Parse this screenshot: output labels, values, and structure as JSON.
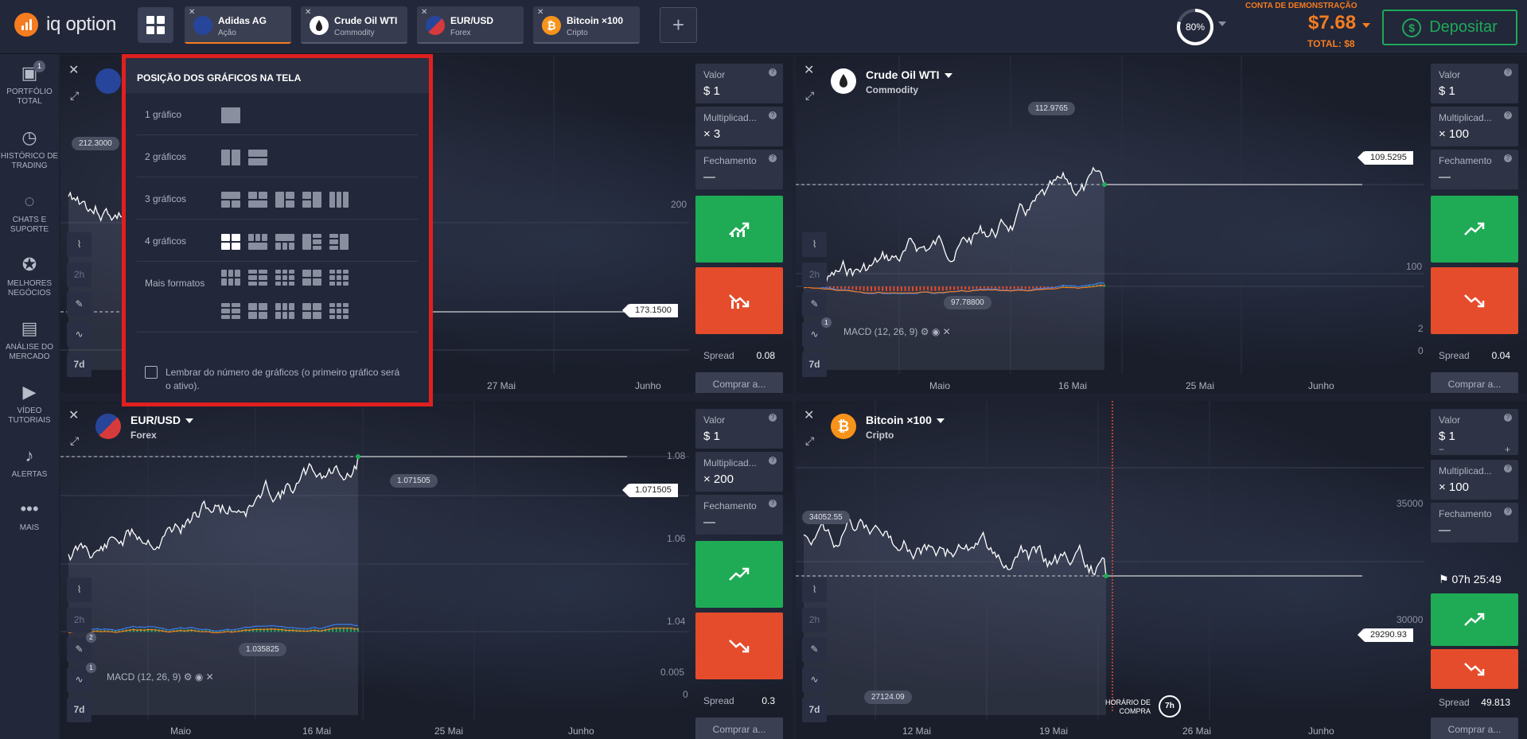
{
  "app": {
    "logo": "iq option"
  },
  "tabs": [
    {
      "name": "Adidas AG",
      "sub": "Ação",
      "icon": "adidas-icon",
      "color": "#27459a"
    },
    {
      "name": "Crude Oil WTI",
      "sub": "Commodity",
      "icon": "oil-drop-icon",
      "color": "#8a8fa0"
    },
    {
      "name": "EUR/USD",
      "sub": "Forex",
      "icon": "eur-usd-flag-icon",
      "color": "#27459a"
    },
    {
      "name": "Bitcoin ×100",
      "sub": "Cripto",
      "icon": "bitcoin-icon",
      "color": "#f7931a"
    }
  ],
  "header": {
    "progress": "80%",
    "progress_value": 0.8,
    "demo_label": "CONTA DE DEMONSTRAÇÃO",
    "balance": "$7.68",
    "total": "TOTAL: $8",
    "deposit": "Depositar"
  },
  "sidebar": [
    {
      "label": "PORTFÓLIO TOTAL",
      "icon": "briefcase-icon",
      "badge": "1"
    },
    {
      "label": "HISTÓRICO DE TRADING",
      "icon": "history-icon"
    },
    {
      "label": "CHATS E SUPORTE",
      "icon": "chat-icon"
    },
    {
      "label": "MELHORES NEGÓCIOS",
      "icon": "trophy-icon"
    },
    {
      "label": "ANÁLISE DO MERCADO",
      "icon": "news-icon"
    },
    {
      "label": "VÍDEO TUTORIAIS",
      "icon": "play-icon"
    },
    {
      "label": "ALERTAS",
      "icon": "bell-icon"
    },
    {
      "label": "MAIS",
      "icon": "more-icon"
    }
  ],
  "popup": {
    "title": "POSIÇÃO DOS GRÁFICOS NA TELA",
    "rows": [
      "1 gráfico",
      "2 gráficos",
      "3 gráficos",
      "4 gráficos",
      "Mais formatos"
    ],
    "remember": "Lembrar do número de gráficos (o primeiro gráfico será o ativo)."
  },
  "common": {
    "valor": "Valor",
    "mult": "Multiplicad...",
    "fech": "Fechamento",
    "spread": "Spread",
    "compra": "Comprar a...",
    "dash": "—",
    "tf2h": "2h",
    "tf7d": "7d",
    "q": "?"
  },
  "panels": [
    {
      "title": "Adidas AG",
      "sub": "Ação",
      "valor": "$ 1",
      "mult": "× 3",
      "spread": "0.08",
      "price": "173.1500",
      "y1": "200",
      "ext_low": "",
      "ext_high": "212.3000",
      "x": [
        "27 Mai",
        "Junho"
      ],
      "macd": ""
    },
    {
      "title": "Crude Oil WTI",
      "sub": "Commodity",
      "valor": "$ 1",
      "mult": "× 100",
      "spread": "0.04",
      "price": "109.5295",
      "y1": "100",
      "y2": "2",
      "y3": "0",
      "ext_high": "112.9765",
      "ext_low": "97.78800",
      "x": [
        "Maio",
        "16 Mai",
        "25 Mai",
        "Junho"
      ],
      "macd": "MACD (12, 26, 9)"
    },
    {
      "title": "EUR/USD",
      "sub": "Forex",
      "valor": "$ 1",
      "mult": "× 200",
      "spread": "0.3",
      "price": "1.071505",
      "y1": "1.08",
      "y2": "1.06",
      "y3": "1.04",
      "y4": "0.005",
      "y5": "0",
      "ext_high": "1.071505",
      "ext_low": "1.035825",
      "x": [
        "Maio",
        "16 Mai",
        "25 Mai",
        "Junho"
      ],
      "macd": "MACD (12, 26, 9)"
    },
    {
      "title": "Bitcoin ×100",
      "sub": "Cripto",
      "valor": "$ 1",
      "mult": "× 100",
      "spread": "49.813",
      "price": "29290.93",
      "y1": "35000",
      "y2": "30000",
      "ext_high": "34052.55",
      "ext_low": "27124.09",
      "x": [
        "12 Mai",
        "19 Mai",
        "26 Mai",
        "Junho"
      ],
      "timer": "07h 25:49",
      "buytime": "HORÁRIO DE COMPRA",
      "buytime_val": "7h",
      "stepper": [
        "−",
        "+"
      ]
    }
  ]
}
